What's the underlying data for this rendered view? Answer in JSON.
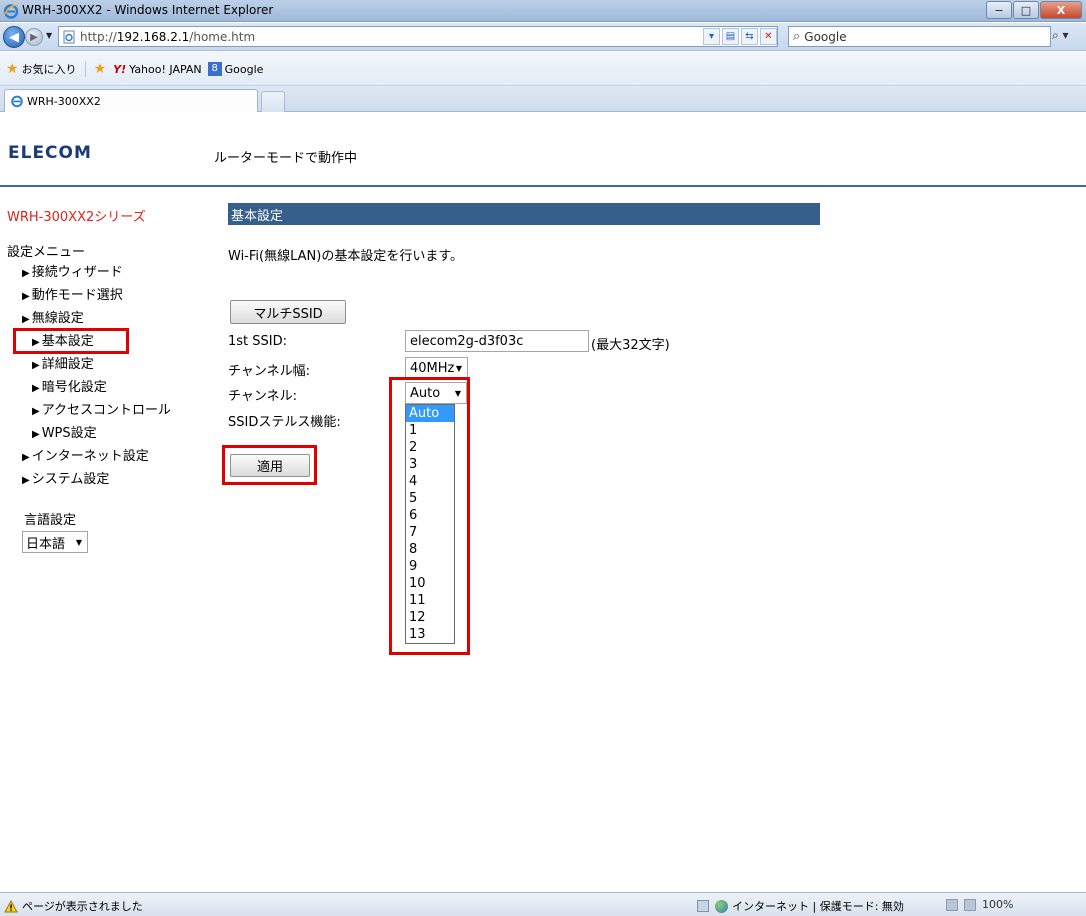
{
  "window": {
    "title": "WRH-300XX2 - Windows Internet Explorer",
    "minimize": "−",
    "maximize": "□",
    "close": "X"
  },
  "address": {
    "url_prefix": "http://",
    "url_host": "192.168.2.1",
    "url_path": "/home.htm",
    "search_placeholder": "Google"
  },
  "favorites": {
    "label": "お気に入り",
    "items": [
      "Yahoo! JAPAN",
      "Google"
    ]
  },
  "tabs": [
    {
      "label": "WRH-300XX2"
    }
  ],
  "header": {
    "logo": "ELECOM",
    "mode": "ルーターモードで動作中"
  },
  "sidebar": {
    "series": "WRH-300XX2シリーズ",
    "menu_title": "設定メニュー",
    "items": [
      {
        "label": "接続ウィザード"
      },
      {
        "label": "動作モード選択"
      },
      {
        "label": "無線設定"
      },
      {
        "label": "基本設定"
      },
      {
        "label": "詳細設定"
      },
      {
        "label": "暗号化設定"
      },
      {
        "label": "アクセスコントロール"
      },
      {
        "label": "WPS設定"
      },
      {
        "label": "インターネット設定"
      },
      {
        "label": "システム設定"
      }
    ],
    "lang_title": "言語設定",
    "lang_value": "日本語"
  },
  "main": {
    "section_title": "基本設定",
    "description": "Wi-Fi(無線LAN)の基本設定を行います。",
    "multi_ssid_button": "マルチSSID",
    "labels": {
      "ssid": "1st SSID:",
      "channel_width": "チャンネル幅:",
      "channel": "チャンネル:",
      "stealth": "SSIDステルス機能:"
    },
    "ssid_value": "elecom2g-d3f03c",
    "ssid_hint": "(最大32文字)",
    "channel_width_value": "40MHz",
    "channel_value": "Auto",
    "channel_options": [
      "Auto",
      "1",
      "2",
      "3",
      "4",
      "5",
      "6",
      "7",
      "8",
      "9",
      "10",
      "11",
      "12",
      "13"
    ],
    "apply_button": "適用"
  },
  "status": {
    "left": "ページが表示されました",
    "zone": "インターネット | 保護モード: 無効",
    "zoom": "100%"
  },
  "colors": {
    "header_line": "#3a6d9f",
    "section_bar": "#365f8c",
    "series_red": "#e2231a",
    "highlight": "#e00000",
    "selected_option": "#3399ff"
  }
}
